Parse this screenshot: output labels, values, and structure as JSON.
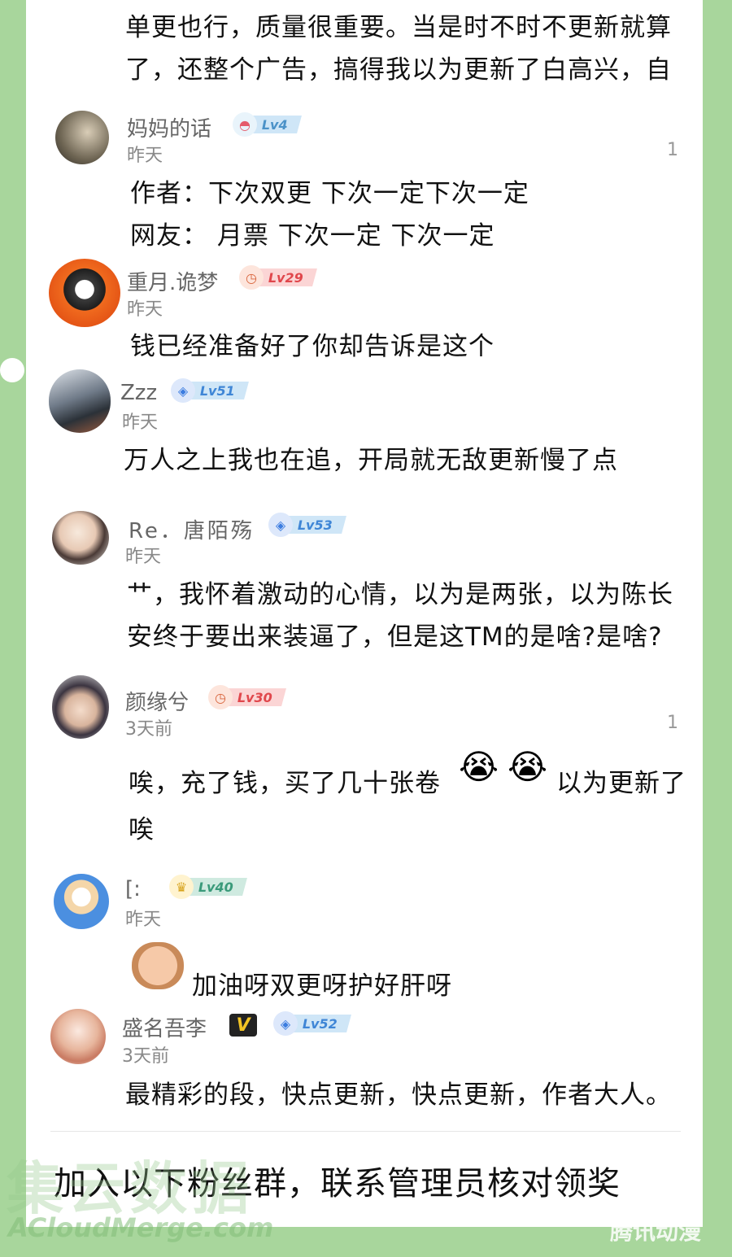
{
  "top_comment": {
    "line1": "单更也行，质量很重要。当是时不时不更新就算",
    "line2": "了，还整个广告，搞得我以为更新了白高兴，自"
  },
  "comments": [
    {
      "name": "妈妈的话",
      "level": "Lv4",
      "time": "昨天",
      "likes": "1",
      "lines": [
        "作者：下次双更  下次一定下次一定",
        "网友：   月票 下次一定 下次一定"
      ]
    },
    {
      "name": "重月.诡梦",
      "level": "Lv29",
      "time": "昨天",
      "likes": "",
      "lines": [
        "钱已经准备好了你却告诉是这个"
      ]
    },
    {
      "name": "Zzz",
      "level": "Lv51",
      "time": "昨天",
      "likes": "",
      "lines": [
        "万人之上我也在追，开局就无敌更新慢了点"
      ]
    },
    {
      "name": "Re．唐陌殇",
      "level": "Lv53",
      "time": "昨天",
      "likes": "",
      "lines": [
        "艹，我怀着激动的心情，以为是两张，以为陈长",
        "安终于要出来装逼了，但是这TM的是啥?是啥?"
      ]
    },
    {
      "name": "颜缘兮",
      "level": "Lv30",
      "time": "3天前",
      "likes": "1",
      "lines": [
        "唉，充了钱，买了几十张卷",
        "以为更新了",
        "唉"
      ],
      "emoji": "😭"
    },
    {
      "name": "[:",
      "level": "Lv40",
      "time": "昨天",
      "likes": "",
      "lines": [
        "加油呀双更呀护好肝呀"
      ]
    },
    {
      "name": "盛名吾李",
      "level": "Lv52",
      "vip": "V",
      "time": "3天前",
      "likes": "",
      "lines": [
        "最精彩的段，快点更新，快点更新，作者大人。"
      ]
    }
  ],
  "footer": "加入以下粉丝群，联系管理员核对领奖",
  "watermarks": {
    "main": "集云数据",
    "site": "ACloudMerge.com",
    "corner": "腾讯动漫"
  },
  "colors": {
    "frame_green": "#a8d69c",
    "panel": "#ffffff",
    "badge_blue": "#cfe6f7",
    "badge_red": "#fbd5d5"
  }
}
